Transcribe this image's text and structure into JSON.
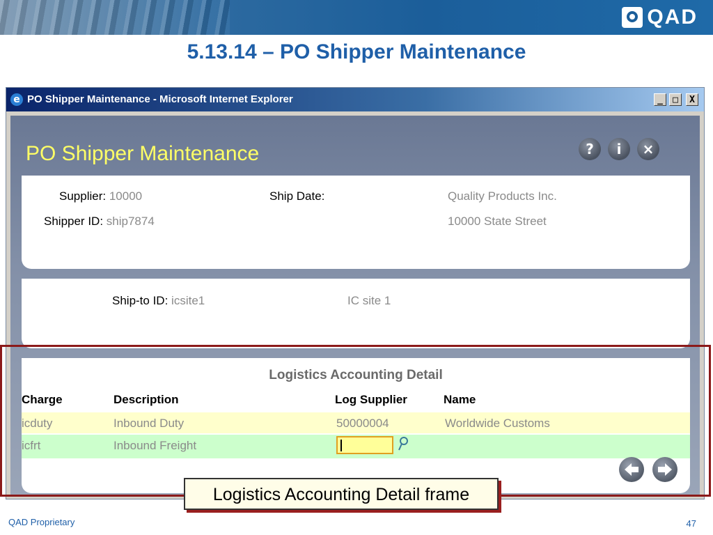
{
  "slide": {
    "logo_text": "QAD",
    "title": "5.13.14 – PO Shipper Maintenance",
    "footer_left": "QAD Proprietary",
    "page_number": "47",
    "callout": "Logistics Accounting Detail frame",
    "callout_color": "#8b1a1a",
    "title_color": "#1f5fa8"
  },
  "window": {
    "title": "PO Shipper Maintenance - Microsoft Internet Explorer",
    "minimize": "_",
    "maximize": "□",
    "close": "X"
  },
  "app": {
    "title": "PO Shipper Maintenance",
    "title_color": "#ffff66",
    "help_icon": "?",
    "info_icon": "i",
    "close_icon": "×",
    "header": {
      "supplier_label": "Supplier:",
      "supplier_value": "10000",
      "shipper_id_label": "Shipper ID:",
      "shipper_id_value": "ship7874",
      "ship_date_label": "Ship Date:",
      "supplier_name": "Quality Products Inc.",
      "supplier_address": "10000 State Street"
    },
    "shipto": {
      "label": "Ship-to ID:",
      "value": "icsite1",
      "name": "IC site 1"
    },
    "grid": {
      "title": "Logistics Accounting Detail",
      "columns": [
        "Charge",
        "Description",
        "Log Supplier",
        "Name"
      ],
      "rows": [
        {
          "charge": "icduty",
          "description": "Inbound Duty",
          "log_supplier": "50000004",
          "name": "Worldwide Customs",
          "bg": "#ffffcc"
        },
        {
          "charge": "icfrt",
          "description": "Inbound Freight",
          "log_supplier": "",
          "name": "",
          "bg": "#ccffcc"
        }
      ]
    },
    "nav": {
      "back_icon": "arrow-left-icon",
      "forward_icon": "arrow-right-icon"
    }
  }
}
